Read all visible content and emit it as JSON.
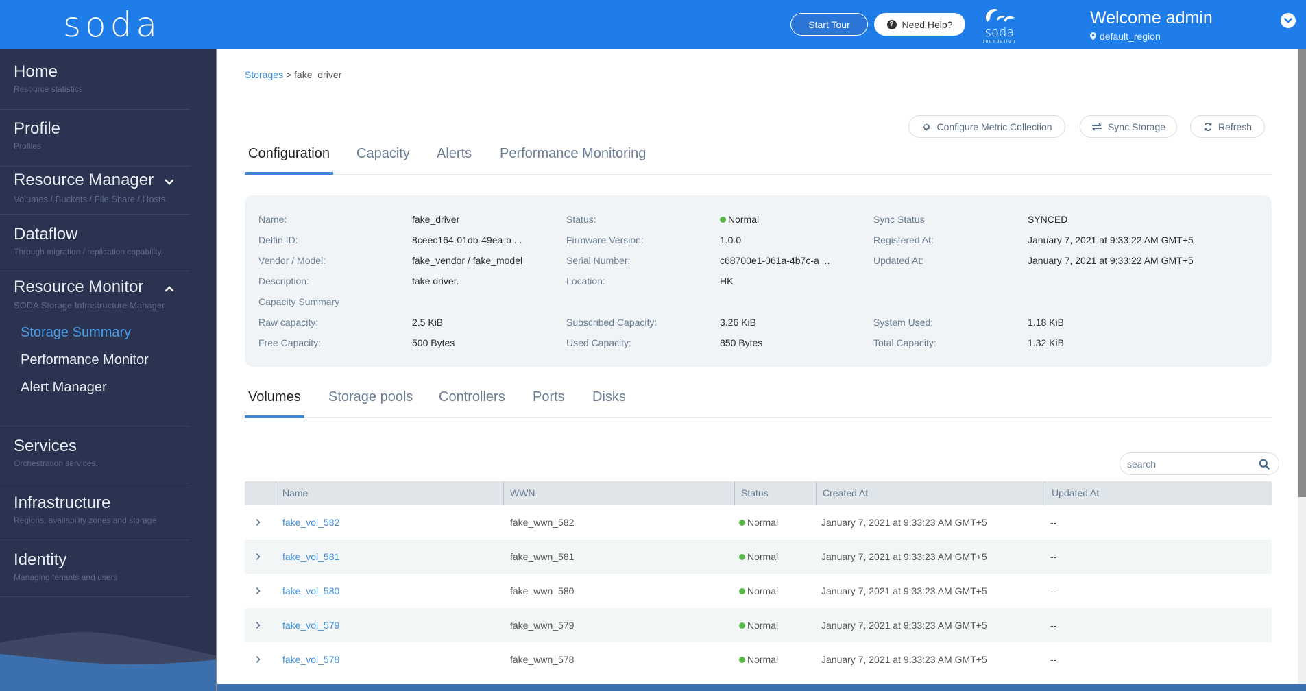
{
  "header": {
    "logo": "soda",
    "start_tour": "Start Tour",
    "need_help": "Need Help?",
    "help_icon_glyph": "?",
    "foundation_logo_text": "soda",
    "foundation_logo_sub": "foundation",
    "welcome": "Welcome admin",
    "region": "default_region",
    "colors": {
      "brand": "#1e7de9"
    }
  },
  "sidebar": {
    "items": [
      {
        "title": "Home",
        "subtitle": "Resource statistics"
      },
      {
        "title": "Profile",
        "subtitle": "Profiles"
      },
      {
        "title": "Resource Manager",
        "subtitle": "Volumes / Buckets / File Share / Hosts",
        "expanded": false
      },
      {
        "title": "Dataflow",
        "subtitle": "Through migration / replication capability."
      },
      {
        "title": "Resource Monitor",
        "subtitle": "SODA Storage Infrastructure Manager",
        "expanded": true,
        "children": [
          {
            "label": "Storage Summary",
            "active": true
          },
          {
            "label": "Performance Monitor",
            "active": false
          },
          {
            "label": "Alert Manager",
            "active": false
          }
        ]
      },
      {
        "title": "Services",
        "subtitle": "Orchestration services."
      },
      {
        "title": "Infrastructure",
        "subtitle": "Regions, availability zones and storage"
      },
      {
        "title": "Identity",
        "subtitle": "Managing tenants and users"
      }
    ]
  },
  "breadcrumb": {
    "parent": "Storages",
    "separator": " > ",
    "current": "fake_driver"
  },
  "actions": {
    "configure": "Configure Metric Collection",
    "sync": "Sync Storage",
    "refresh": "Refresh"
  },
  "main_tabs": [
    {
      "label": "Configuration",
      "active": true
    },
    {
      "label": "Capacity",
      "active": false
    },
    {
      "label": "Alerts",
      "active": false
    },
    {
      "label": "Performance Monitoring",
      "active": false
    }
  ],
  "details": {
    "col1": [
      {
        "label": "Name:",
        "value": "fake_driver"
      },
      {
        "label": "Delfin ID:",
        "value": "8ceec164-01db-49ea-b ..."
      },
      {
        "label": "Vendor / Model:",
        "value": "fake_vendor / fake_model"
      },
      {
        "label": "Description:",
        "value": "fake driver."
      }
    ],
    "col2": [
      {
        "label": "Status:",
        "value": "Normal"
      },
      {
        "label": "Firmware Version:",
        "value": "1.0.0"
      },
      {
        "label": "Serial Number:",
        "value": "c68700e1-061a-4b7c-a ..."
      },
      {
        "label": "Location:",
        "value": "HK"
      }
    ],
    "col3": [
      {
        "label": "Sync Status",
        "value": "SYNCED"
      },
      {
        "label": "Registered At:",
        "value": "January 7, 2021 at 9:33:22 AM GMT+5"
      },
      {
        "label": "Updated At:",
        "value": "January 7, 2021 at 9:33:22 AM GMT+5"
      }
    ],
    "capacity_heading": "Capacity Summary",
    "capacity": [
      {
        "label": "Raw capacity:",
        "value": "2.5 KiB"
      },
      {
        "label": "Subscribed Capacity:",
        "value": "3.26 KiB"
      },
      {
        "label": "System Used:",
        "value": "1.18 KiB"
      },
      {
        "label": "Free Capacity:",
        "value": "500 Bytes"
      },
      {
        "label": "Used Capacity:",
        "value": "850 Bytes"
      },
      {
        "label": "Total Capacity:",
        "value": "1.32 KiB"
      }
    ],
    "status_color": "#58b847"
  },
  "sub_tabs": [
    {
      "label": "Volumes",
      "active": true
    },
    {
      "label": "Storage pools",
      "active": false
    },
    {
      "label": "Controllers",
      "active": false
    },
    {
      "label": "Ports",
      "active": false
    },
    {
      "label": "Disks",
      "active": false
    }
  ],
  "search": {
    "placeholder": "search",
    "value": ""
  },
  "table": {
    "columns": [
      "Name",
      "WWN",
      "Status",
      "Created At",
      "Updated At"
    ],
    "rows": [
      {
        "name": "fake_vol_582",
        "wwn": "fake_wwn_582",
        "status": "Normal",
        "created": "January 7, 2021 at 9:33:23 AM GMT+5",
        "updated": "--"
      },
      {
        "name": "fake_vol_581",
        "wwn": "fake_wwn_581",
        "status": "Normal",
        "created": "January 7, 2021 at 9:33:23 AM GMT+5",
        "updated": "--"
      },
      {
        "name": "fake_vol_580",
        "wwn": "fake_wwn_580",
        "status": "Normal",
        "created": "January 7, 2021 at 9:33:23 AM GMT+5",
        "updated": "--"
      },
      {
        "name": "fake_vol_579",
        "wwn": "fake_wwn_579",
        "status": "Normal",
        "created": "January 7, 2021 at 9:33:23 AM GMT+5",
        "updated": "--"
      },
      {
        "name": "fake_vol_578",
        "wwn": "fake_wwn_578",
        "status": "Normal",
        "created": "January 7, 2021 at 9:33:23 AM GMT+5",
        "updated": "--"
      }
    ]
  }
}
